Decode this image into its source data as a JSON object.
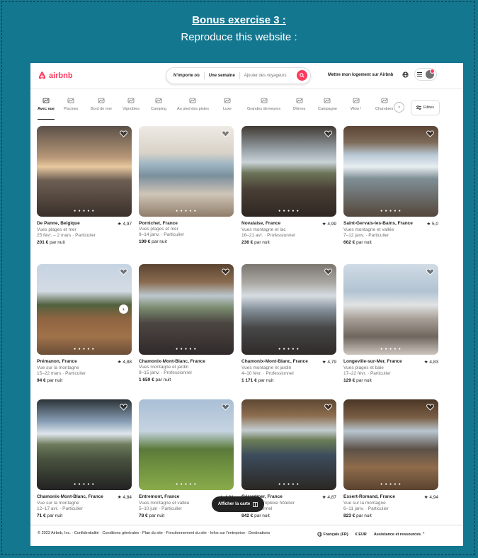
{
  "header": {
    "title": "Bonus exercise 3 :",
    "subtitle": "Reproduce this website :"
  },
  "nav": {
    "logo_text": "airbnb",
    "search_anywhere": "N'importe où",
    "search_week": "Une semaine",
    "search_guests_placeholder": "Ajouter des voyageurs",
    "host_link": "Mettre mon logement sur Airbnb",
    "brand_color": "#ff385c"
  },
  "categories": [
    {
      "label": "Avec vue",
      "icon": "view-icon",
      "active": true
    },
    {
      "label": "Piscines",
      "icon": "pool-icon"
    },
    {
      "label": "Bord de mer",
      "icon": "beach-icon"
    },
    {
      "label": "Vignobles",
      "icon": "vineyard-icon"
    },
    {
      "label": "Camping",
      "icon": "camping-icon"
    },
    {
      "label": "Au pied des pistes",
      "icon": "ski-icon"
    },
    {
      "label": "Luxe",
      "icon": "luxe-icon"
    },
    {
      "label": "Grandes demeures",
      "icon": "mansion-icon"
    },
    {
      "label": "Dômes",
      "icon": "dome-icon"
    },
    {
      "label": "Campagne",
      "icon": "countryside-icon"
    },
    {
      "label": "Wow !",
      "icon": "wow-icon"
    },
    {
      "label": "Chambres",
      "icon": "room-icon"
    }
  ],
  "filters_label": "Filtres",
  "listings": [
    {
      "title": "De Panne, Belgique",
      "rating": "4,97",
      "line2": "Vues plages et mer",
      "line3": "25 févr. – 2 mars · Particulier",
      "price": "201 €",
      "price_suffix": "par nuit"
    },
    {
      "title": "Pornichet, France",
      "rating": "",
      "line2": "Vues plages et mer",
      "line3": "9–14 janv. · Particulier",
      "price": "199 €",
      "price_suffix": "par nuit"
    },
    {
      "title": "Novalaise, France",
      "rating": "4,99",
      "line2": "Vues montagne et lac",
      "line3": "16–21 avr. · Professionnel",
      "price": "236 €",
      "price_suffix": "par nuit"
    },
    {
      "title": "Saint-Gervais-les-Bains, France",
      "rating": "5,0",
      "line2": "Vues montagne et vallée",
      "line3": "7–12 janv. · Particulier",
      "price": "662 €",
      "price_suffix": "par nuit"
    },
    {
      "title": "Prémanon, France",
      "rating": "4,88",
      "line2": "Vue sur la montagne",
      "line3": "15–22 mars · Particulier",
      "price": "94 €",
      "price_suffix": "par nuit"
    },
    {
      "title": "Chamonix-Mont-Blanc, France",
      "rating": "",
      "line2": "Vues montagne et jardin",
      "line3": "9–15 janv. · Professionnel",
      "price": "1 659 €",
      "price_suffix": "par nuit"
    },
    {
      "title": "Chamonix-Mont-Blanc, France",
      "rating": "4,79",
      "line2": "Vues montagne et jardin",
      "line3": "4–10 févr. · Professionnel",
      "price": "1 171 €",
      "price_suffix": "par nuit"
    },
    {
      "title": "Longeville-sur-Mer, France",
      "rating": "4,83",
      "line2": "Vues plages et baie",
      "line3": "17–22 févr. · Particulier",
      "price": "129 €",
      "price_suffix": "par nuit"
    },
    {
      "title": "Chamonix-Mont-Blanc, France",
      "rating": "4,84",
      "line2": "Vue sur la montagne",
      "line3": "12–17 avr. · Particulier",
      "price": "71 €",
      "price_suffix": "par nuit"
    },
    {
      "title": "Entremont, France",
      "rating": "4,91",
      "line2": "Vues montagne et vallée",
      "line3": "5–10 juin · Particulier",
      "price": "78 €",
      "price_suffix": "par nuit"
    },
    {
      "title": "Gérardmer, France",
      "rating": "4,87",
      "line2": "Vue sur complexe hôtelier",
      "line3": "· Professionnel",
      "price": "842 €",
      "price_suffix": "par nuit"
    },
    {
      "title": "Essert-Romand, France",
      "rating": "4,94",
      "line2": "Vue sur la montagne",
      "line3": "6–11 janv. · Particulier",
      "price": "823 €",
      "price_suffix": "par nuit"
    }
  ],
  "map_button": "Afficher la carte",
  "footer": {
    "links": "© 2023 Airbnb, Inc.  ·  Confidentialité  ·  Conditions générales  ·  Plan du site  ·  Fonctionnement du site  ·  Infos sur l'entreprise  ·  Destinations",
    "language": "Français (FR)",
    "currency": "€ EUR",
    "support": "Assistance et ressources"
  }
}
